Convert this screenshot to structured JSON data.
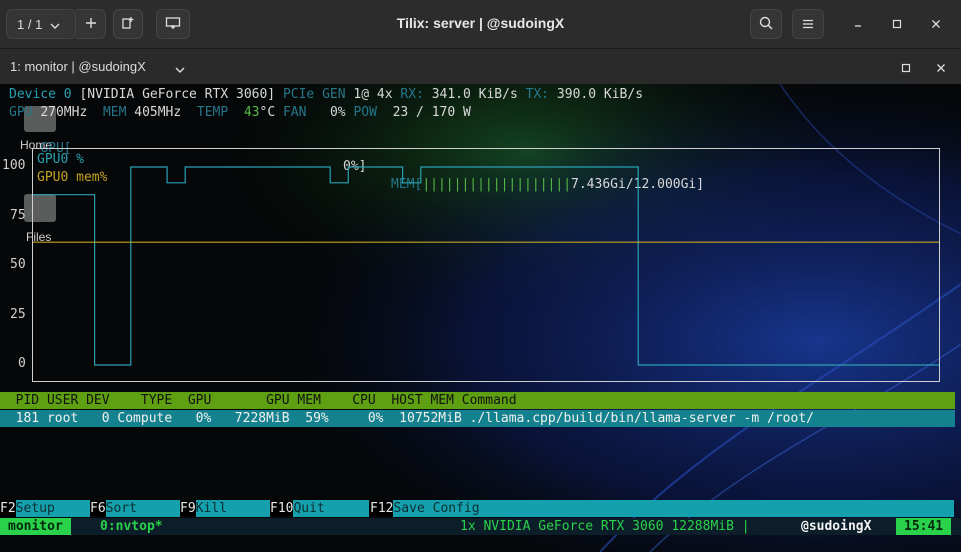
{
  "window": {
    "title": "Tilix: server | @sudoingX",
    "session_counter": "1 / 1",
    "tab_title": "1: monitor | @sudoingX"
  },
  "nvtop": {
    "line1": {
      "device": "Device 0",
      "gpu_name": "[NVIDIA GeForce RTX 3060]",
      "pcie_label": "PCIe GEN",
      "pcie_value": "1@ 4x",
      "rx_label": "RX:",
      "rx_value": "341.0 KiB/s",
      "tx_label": "TX:",
      "tx_value": "390.0 KiB/s"
    },
    "line2": {
      "gpu_label": "GPU",
      "gpu_clock": "270MHz",
      "mem_label": "MEM",
      "mem_clock": "405MHz",
      "temp_label": "TEMP",
      "temp_value": "43",
      "temp_unit": "°C",
      "fan_label": "FAN",
      "fan_value": "0%",
      "pow_label": "POW",
      "pow_value": "23 / 170 W"
    },
    "line3": {
      "gpu_label": "GPU[",
      "gpu_util": "0%]",
      "mem_label": "MEM[",
      "mem_bars": "|||||||||||||||||||",
      "mem_usage": "7.436Gi/12.000Gi]"
    },
    "desktop": {
      "home_label": "Home",
      "files_label": "Files"
    }
  },
  "chart_data": {
    "type": "line",
    "ylim": [
      0,
      100
    ],
    "yticks": [
      "100",
      "75",
      "50",
      "25",
      "0"
    ],
    "series": [
      {
        "name": "GPU0 %",
        "color": "#2aa1b3",
        "x": [
          0,
          6.8,
          6.8,
          10.8,
          10.8,
          14.8,
          14.8,
          16.8,
          16.8,
          32.8,
          32.8,
          34.8,
          34.8,
          40.8,
          40.8,
          42.8,
          42.8,
          66.8,
          66.8,
          100
        ],
        "y": [
          86,
          86,
          0,
          0,
          100,
          100,
          92,
          92,
          100,
          100,
          92,
          92,
          100,
          100,
          92,
          92,
          100,
          100,
          0,
          0
        ]
      },
      {
        "name": "GPU0 mem%",
        "color": "#c5a320",
        "x": [
          0,
          100
        ],
        "y": [
          62,
          62
        ]
      }
    ]
  },
  "process_table": {
    "header": "  PID USER DEV    TYPE  GPU       GPU MEM    CPU  HOST MEM Command",
    "rows": [
      "  181 root   0 Compute   0%   7228MiB  59%     0%  10752MiB ./llama.cpp/build/bin/llama-server -m /root/"
    ]
  },
  "function_keys": [
    {
      "key": "F2",
      "label": "Setup"
    },
    {
      "key": "F6",
      "label": "Sort"
    },
    {
      "key": "F9",
      "label": "Kill"
    },
    {
      "key": "F10",
      "label": "Quit"
    },
    {
      "key": "F12",
      "label": "Save Config"
    }
  ],
  "tmux_status": {
    "session": "monitor",
    "window": "0:nvtop*",
    "right_info": "1x NVIDIA GeForce RTX 3060 12288MiB |",
    "user": "@sudoingX",
    "time": "15:41"
  }
}
